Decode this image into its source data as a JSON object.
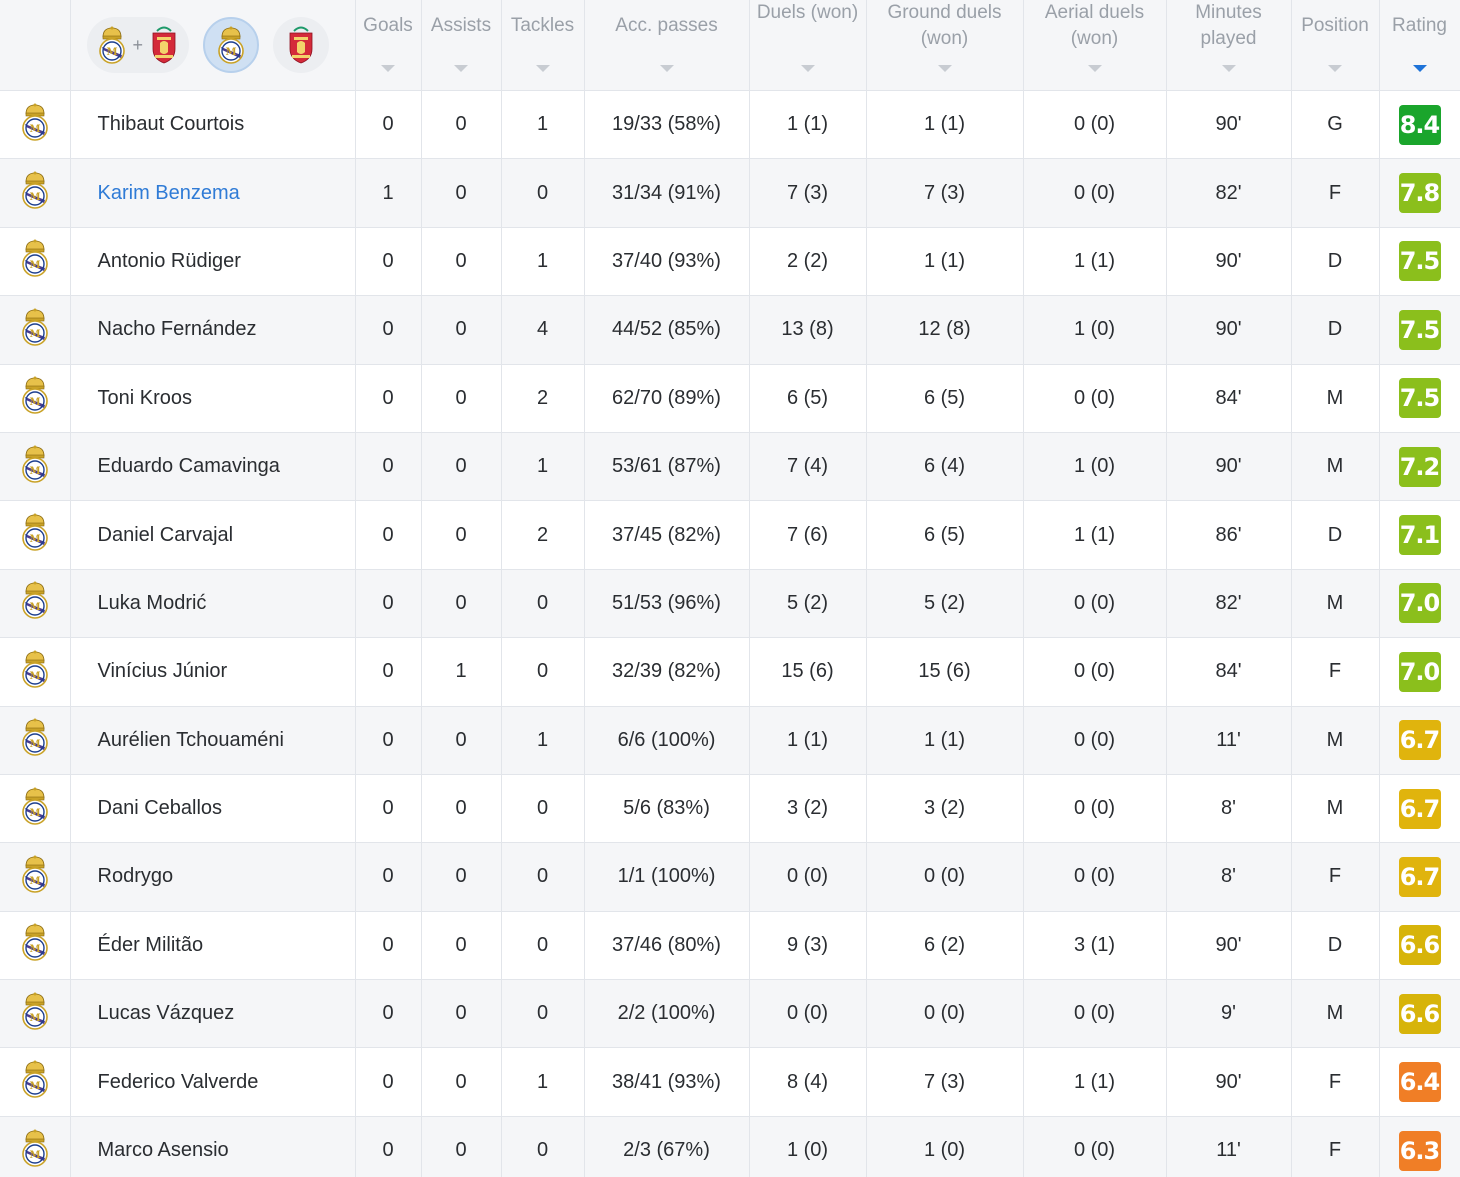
{
  "filters": {
    "teams": [
      {
        "name": "rm-liverpool-combined",
        "selected": false
      },
      {
        "name": "real-madrid",
        "selected": true
      },
      {
        "name": "liverpool",
        "selected": false
      }
    ],
    "plus_symbol": "+"
  },
  "columns": {
    "goals": "Goals",
    "assists": "Assists",
    "tackles": "Tackles",
    "acc_passes": "Acc. passes",
    "duels": "Duels (won)",
    "ground_duels": "Ground duels (won)",
    "aerial_duels": "Aerial duels (won)",
    "minutes_played": "Minutes played",
    "position": "Position",
    "rating": "Rating"
  },
  "sorted_by": "rating",
  "rating_colors": {
    "8.4": "#1aa52c",
    "7.8": "#8bbf1c",
    "7.5": "#8bbf1c",
    "7.2": "#8bbf1c",
    "7.1": "#8bbf1c",
    "7.0": "#8bbf1c",
    "6.7": "#e0b40d",
    "6.6": "#d7b40a",
    "6.4": "#f07e26",
    "6.3": "#f07e26"
  },
  "players": [
    {
      "name": "Thibaut Courtois",
      "goals": "0",
      "assists": "0",
      "tackles": "1",
      "acc_passes": "19/33 (58%)",
      "duels": "1 (1)",
      "ground_duels": "1 (1)",
      "aerial_duels": "0 (0)",
      "minutes": "90'",
      "position": "G",
      "rating": "8.4",
      "color": "#1aa52c",
      "link": false
    },
    {
      "name": "Karim Benzema",
      "goals": "1",
      "assists": "0",
      "tackles": "0",
      "acc_passes": "31/34 (91%)",
      "duels": "7 (3)",
      "ground_duels": "7 (3)",
      "aerial_duels": "0 (0)",
      "minutes": "82'",
      "position": "F",
      "rating": "7.8",
      "color": "#8bbf1c",
      "link": true
    },
    {
      "name": "Antonio Rüdiger",
      "goals": "0",
      "assists": "0",
      "tackles": "1",
      "acc_passes": "37/40 (93%)",
      "duels": "2 (2)",
      "ground_duels": "1 (1)",
      "aerial_duels": "1 (1)",
      "minutes": "90'",
      "position": "D",
      "rating": "7.5",
      "color": "#8bbf1c",
      "link": false
    },
    {
      "name": "Nacho Fernández",
      "goals": "0",
      "assists": "0",
      "tackles": "4",
      "acc_passes": "44/52 (85%)",
      "duels": "13 (8)",
      "ground_duels": "12 (8)",
      "aerial_duels": "1 (0)",
      "minutes": "90'",
      "position": "D",
      "rating": "7.5",
      "color": "#8bbf1c",
      "link": false
    },
    {
      "name": "Toni Kroos",
      "goals": "0",
      "assists": "0",
      "tackles": "2",
      "acc_passes": "62/70 (89%)",
      "duels": "6 (5)",
      "ground_duels": "6 (5)",
      "aerial_duels": "0 (0)",
      "minutes": "84'",
      "position": "M",
      "rating": "7.5",
      "color": "#8bbf1c",
      "link": false
    },
    {
      "name": "Eduardo Camavinga",
      "goals": "0",
      "assists": "0",
      "tackles": "1",
      "acc_passes": "53/61 (87%)",
      "duels": "7 (4)",
      "ground_duels": "6 (4)",
      "aerial_duels": "1 (0)",
      "minutes": "90'",
      "position": "M",
      "rating": "7.2",
      "color": "#8bbf1c",
      "link": false
    },
    {
      "name": "Daniel Carvajal",
      "goals": "0",
      "assists": "0",
      "tackles": "2",
      "acc_passes": "37/45 (82%)",
      "duels": "7 (6)",
      "ground_duels": "6 (5)",
      "aerial_duels": "1 (1)",
      "minutes": "86'",
      "position": "D",
      "rating": "7.1",
      "color": "#8bbf1c",
      "link": false
    },
    {
      "name": "Luka Modrić",
      "goals": "0",
      "assists": "0",
      "tackles": "0",
      "acc_passes": "51/53 (96%)",
      "duels": "5 (2)",
      "ground_duels": "5 (2)",
      "aerial_duels": "0 (0)",
      "minutes": "82'",
      "position": "M",
      "rating": "7.0",
      "color": "#8bbf1c",
      "link": false
    },
    {
      "name": "Vinícius Júnior",
      "goals": "0",
      "assists": "1",
      "tackles": "0",
      "acc_passes": "32/39 (82%)",
      "duels": "15 (6)",
      "ground_duels": "15 (6)",
      "aerial_duels": "0 (0)",
      "minutes": "84'",
      "position": "F",
      "rating": "7.0",
      "color": "#8bbf1c",
      "link": false
    },
    {
      "name": "Aurélien Tchouaméni",
      "goals": "0",
      "assists": "0",
      "tackles": "1",
      "acc_passes": "6/6 (100%)",
      "duels": "1 (1)",
      "ground_duels": "1 (1)",
      "aerial_duels": "0 (0)",
      "minutes": "11'",
      "position": "M",
      "rating": "6.7",
      "color": "#e0b40d",
      "link": false
    },
    {
      "name": "Dani Ceballos",
      "goals": "0",
      "assists": "0",
      "tackles": "0",
      "acc_passes": "5/6 (83%)",
      "duels": "3 (2)",
      "ground_duels": "3 (2)",
      "aerial_duels": "0 (0)",
      "minutes": "8'",
      "position": "M",
      "rating": "6.7",
      "color": "#e0b40d",
      "link": false
    },
    {
      "name": "Rodrygo",
      "goals": "0",
      "assists": "0",
      "tackles": "0",
      "acc_passes": "1/1 (100%)",
      "duels": "0 (0)",
      "ground_duels": "0 (0)",
      "aerial_duels": "0 (0)",
      "minutes": "8'",
      "position": "F",
      "rating": "6.7",
      "color": "#e0b40d",
      "link": false
    },
    {
      "name": "Éder Militão",
      "goals": "0",
      "assists": "0",
      "tackles": "0",
      "acc_passes": "37/46 (80%)",
      "duels": "9 (3)",
      "ground_duels": "6 (2)",
      "aerial_duels": "3 (1)",
      "minutes": "90'",
      "position": "D",
      "rating": "6.6",
      "color": "#d7b40a",
      "link": false
    },
    {
      "name": "Lucas Vázquez",
      "goals": "0",
      "assists": "0",
      "tackles": "0",
      "acc_passes": "2/2 (100%)",
      "duels": "0 (0)",
      "ground_duels": "0 (0)",
      "aerial_duels": "0 (0)",
      "minutes": "9'",
      "position": "M",
      "rating": "6.6",
      "color": "#d7b40a",
      "link": false
    },
    {
      "name": "Federico Valverde",
      "goals": "0",
      "assists": "0",
      "tackles": "1",
      "acc_passes": "38/41 (93%)",
      "duels": "8 (4)",
      "ground_duels": "7 (3)",
      "aerial_duels": "1 (1)",
      "minutes": "90'",
      "position": "F",
      "rating": "6.4",
      "color": "#f07e26",
      "link": false
    },
    {
      "name": "Marco Asensio",
      "goals": "0",
      "assists": "0",
      "tackles": "0",
      "acc_passes": "2/3 (67%)",
      "duels": "1 (0)",
      "ground_duels": "1 (0)",
      "aerial_duels": "0 (0)",
      "minutes": "11'",
      "position": "F",
      "rating": "6.3",
      "color": "#f07e26",
      "link": false
    }
  ]
}
